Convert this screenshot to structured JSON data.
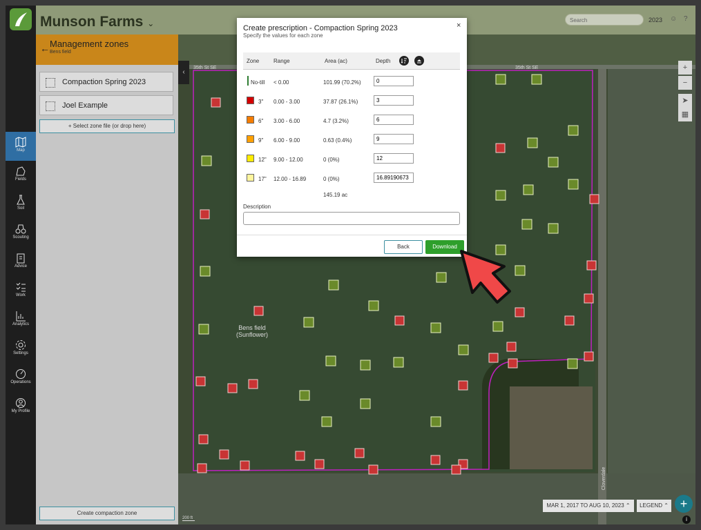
{
  "header": {
    "farm_name": "Munson Farms",
    "search_placeholder": "Search",
    "year": "2023"
  },
  "nav": {
    "items": [
      {
        "label": "Map",
        "icon": "map-icon"
      },
      {
        "label": "Fields",
        "icon": "fields-icon"
      },
      {
        "label": "Soil",
        "icon": "soil-icon"
      },
      {
        "label": "Scouting",
        "icon": "scouting-icon"
      },
      {
        "label": "Advice",
        "icon": "advice-icon"
      },
      {
        "label": "Work",
        "icon": "work-icon"
      },
      {
        "label": "Analytics",
        "icon": "analytics-icon"
      },
      {
        "label": "Settings",
        "icon": "settings-icon"
      },
      {
        "label": "Operations",
        "icon": "operations-icon"
      },
      {
        "label": "My Profile",
        "icon": "profile-icon"
      }
    ]
  },
  "panel": {
    "title": "Management zones",
    "subtitle": "Bens field",
    "zones": [
      "Compaction Spring 2023",
      "Joel Example"
    ],
    "select_label": "+ Select zone file (or drop here)",
    "create_label": "Create compaction zone"
  },
  "map": {
    "road_label_left": "35th St SE",
    "road_label_right": "35th St SE",
    "field_label": "Bens field",
    "crop_label": "(Sunflower)",
    "date_range": "MAR 1, 2017 TO AUG 10, 2023",
    "legend_label": "LEGEND",
    "scale_label": "200 ft",
    "side_road_label": "Cloverdale"
  },
  "modal": {
    "title": "Create prescription - Compaction Spring 2023",
    "subtitle": "Specify the values for each zone",
    "headers": {
      "zone": "Zone",
      "range": "Range",
      "area": "Area (ac)",
      "depth": "Depth"
    },
    "rows": [
      {
        "zone": "No-till",
        "range": "< 0.00",
        "area": "101.99   (70.2%)",
        "depth": "0",
        "color": "#2e7d32"
      },
      {
        "zone": "3\"",
        "range": "0.00 - 3.00",
        "area": "37.87   (26.1%)",
        "depth": "3",
        "color": "#d40000"
      },
      {
        "zone": "6\"",
        "range": "3.00 - 6.00",
        "area": "4.7   (3.2%)",
        "depth": "6",
        "color": "#f57c00"
      },
      {
        "zone": "9\"",
        "range": "6.00 - 9.00",
        "area": "0.63   (0.4%)",
        "depth": "9",
        "color": "#ffa000"
      },
      {
        "zone": "12\"",
        "range": "9.00 - 12.00",
        "area": "0   (0%)",
        "depth": "12",
        "color": "#ffeb00"
      },
      {
        "zone": "17\"",
        "range": "12.00 - 16.89",
        "area": "0   (0%)",
        "depth": "16.89190673",
        "color": "#fff59d"
      }
    ],
    "total": "145.19 ac",
    "description_label": "Description",
    "back_label": "Back",
    "download_label": "Download"
  }
}
